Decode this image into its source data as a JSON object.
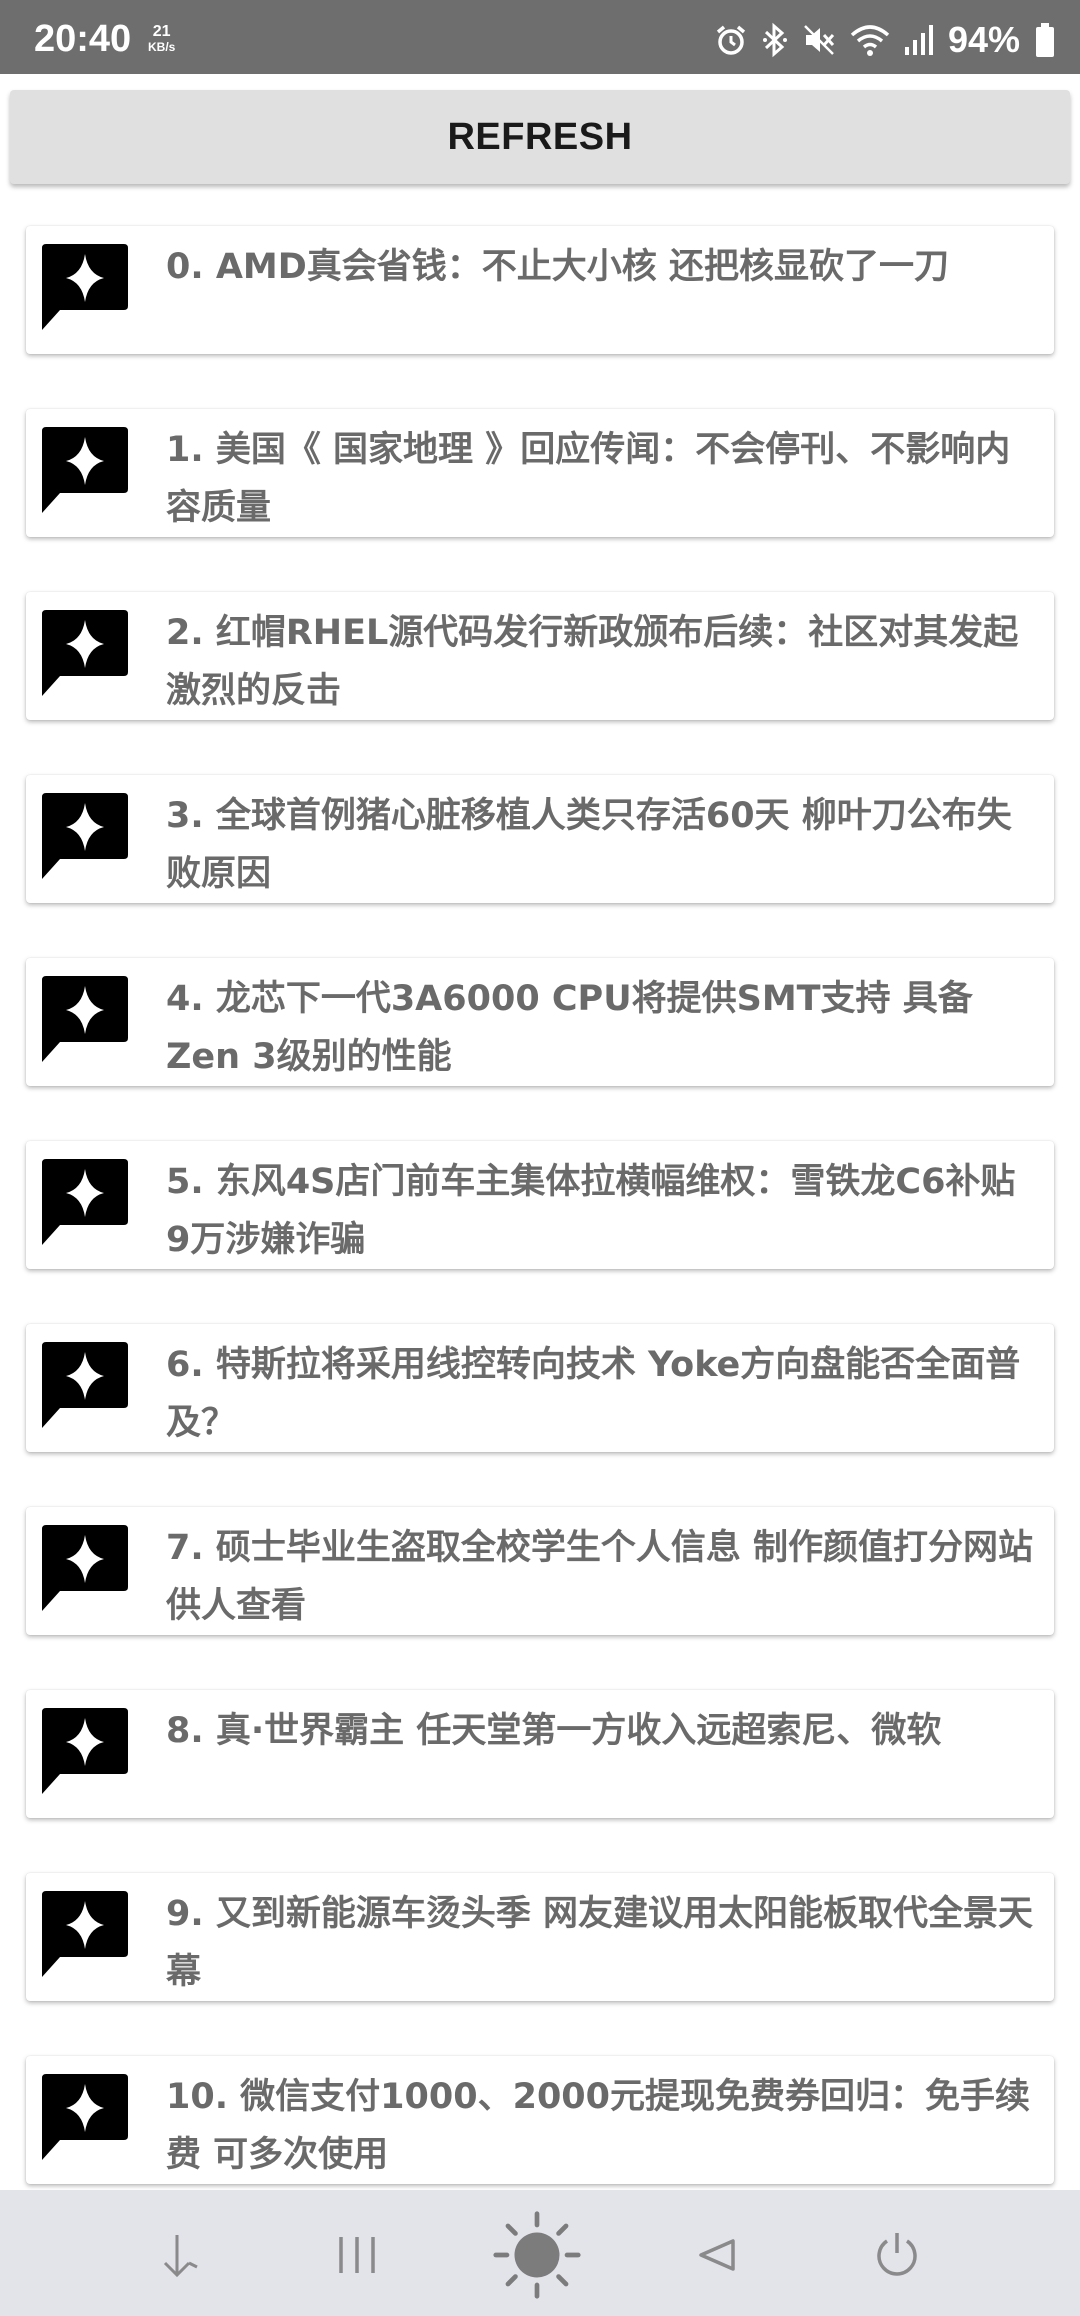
{
  "status_bar": {
    "time": "20:40",
    "net_speed_value": "21",
    "net_speed_unit": "KB/s",
    "battery": "94%",
    "icons": [
      "alarm-icon",
      "bluetooth-icon",
      "mute-icon",
      "wifi-icon",
      "signal-icon",
      "battery-icon"
    ]
  },
  "refresh_label": "REFRESH",
  "news": [
    {
      "title": "0. AMD真会省钱：不止大小核 还把核显砍了一刀"
    },
    {
      "title": "1. 美国《 国家地理 》回应传闻：不会停刊、不影响内容质量"
    },
    {
      "title": "2. 红帽RHEL源代码发行新政颁布后续：社区对其发起激烈的反击"
    },
    {
      "title": "3. 全球首例猪心脏移植人类只存活60天 柳叶刀公布失败原因"
    },
    {
      "title": "4. 龙芯下一代3A6000 CPU将提供SMT支持 具备Zen 3级别的性能"
    },
    {
      "title": "5. 东风4S店门前车主集体拉横幅维权：雪铁龙C6补贴9万涉嫌诈骗"
    },
    {
      "title": "6. 特斯拉将采用线控转向技术 Yoke方向盘能否全面普及？"
    },
    {
      "title": "7. 硕士毕业生盗取全校学生个人信息 制作颜值打分网站供人查看"
    },
    {
      "title": "8. 真·世界霸主 任天堂第一方收入远超索尼、微软"
    },
    {
      "title": "9. 又到新能源车烫头季 网友建议用太阳能板取代全景天幕"
    },
    {
      "title": "10. 微信支付1000、2000元提现免费券回归：免手续费 可多次使用"
    }
  ],
  "nav": [
    "arrow-down-icon",
    "recent-apps-icon",
    "brightness-icon",
    "back-icon",
    "power-icon"
  ],
  "colors": {
    "status_bar": "#6e6e6e",
    "card_text": "#6a6a6a",
    "icon": "#000000",
    "nav_bar": "#e3e3ea"
  }
}
